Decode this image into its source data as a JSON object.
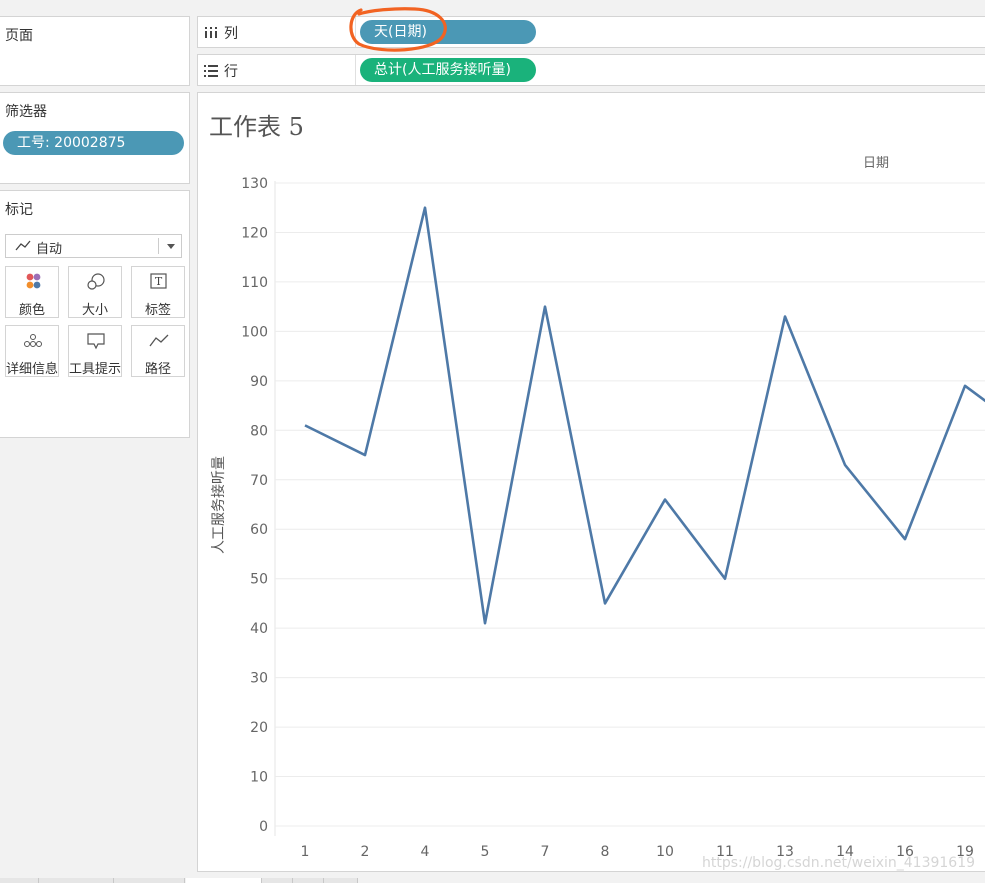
{
  "pages_panel": {
    "title": "页面"
  },
  "filters_panel": {
    "title": "筛选器",
    "filter_pill": "工号: 20002875"
  },
  "marks_panel": {
    "title": "标记",
    "mark_type": "自动",
    "buttons": [
      {
        "label": "颜色",
        "icon": "color-dots-icon"
      },
      {
        "label": "大小",
        "icon": "size-circles-icon"
      },
      {
        "label": "标签",
        "icon": "text-label-icon"
      },
      {
        "label": "详细信息",
        "icon": "detail-dots-icon"
      },
      {
        "label": "工具提示",
        "icon": "tooltip-icon"
      },
      {
        "label": "路径",
        "icon": "path-line-icon"
      }
    ]
  },
  "columns_shelf": {
    "label": "列",
    "icon": "columns-icon",
    "pill": "天(日期)"
  },
  "rows_shelf": {
    "label": "行",
    "icon": "rows-icon",
    "pill": "总计(人工服务接听量)"
  },
  "sheet": {
    "title": "工作表 5"
  },
  "watermark": "https://blog.csdn.net/weixin_41391619",
  "colors": {
    "line": "#4e79a7",
    "blue_pill": "#4b98b5",
    "green_pill": "#1ab27b",
    "annotation": "#f26322"
  },
  "chart_data": {
    "type": "line",
    "header_label": "日期",
    "ylabel": "人工服务接听量",
    "ylim": [
      0,
      130
    ],
    "yticks": [
      0,
      10,
      20,
      30,
      40,
      50,
      60,
      70,
      80,
      90,
      100,
      110,
      120,
      130
    ],
    "categories": [
      "1",
      "2",
      "4",
      "5",
      "7",
      "8",
      "10",
      "11",
      "13",
      "14",
      "16",
      "19"
    ],
    "values": [
      81,
      75,
      125,
      41,
      105,
      45,
      66,
      50,
      103,
      73,
      58,
      89
    ],
    "trailing_value": 80,
    "grid": true
  }
}
